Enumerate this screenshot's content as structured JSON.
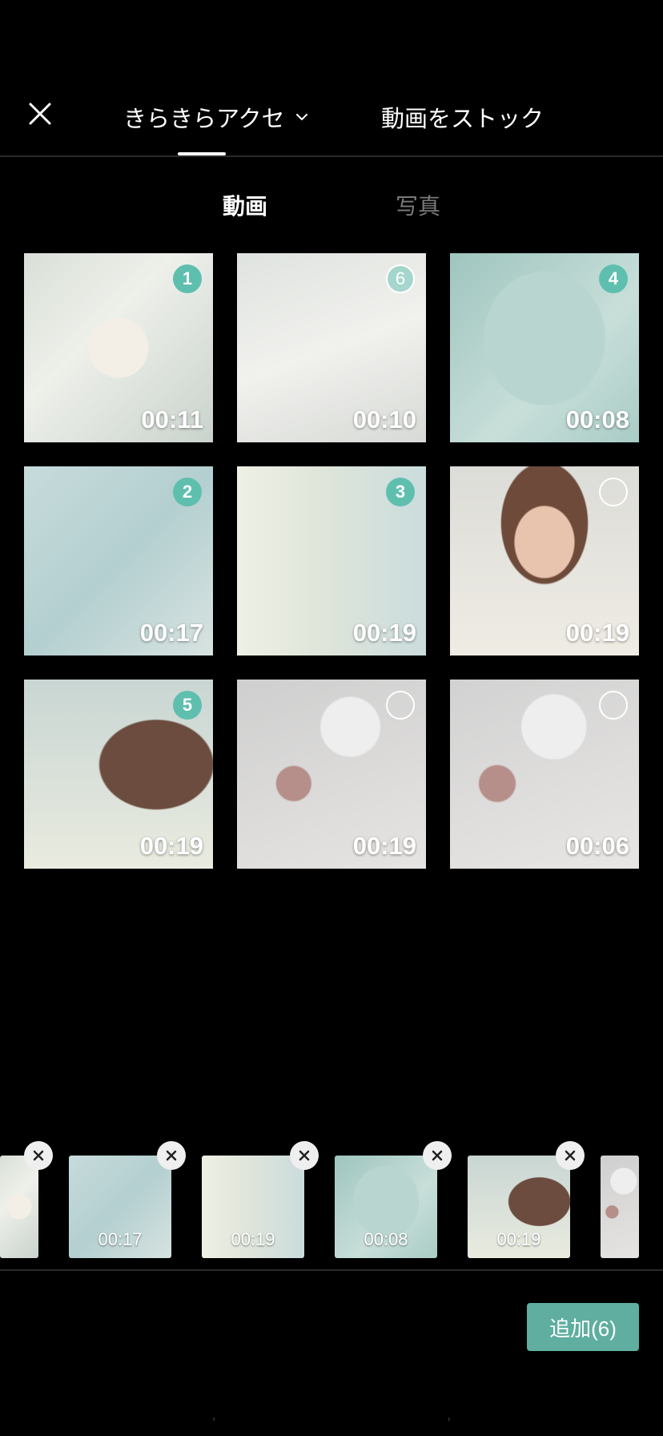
{
  "header": {
    "album_label": "きらきらアクセ",
    "stock_label": "動画をストック"
  },
  "subtabs": {
    "video": "動画",
    "photo": "写真"
  },
  "grid": [
    {
      "duration": "00:11",
      "badge": "1",
      "state": "selected"
    },
    {
      "duration": "00:10",
      "badge": "6",
      "state": "selected-latest"
    },
    {
      "duration": "00:08",
      "badge": "4",
      "state": "selected"
    },
    {
      "duration": "00:17",
      "badge": "2",
      "state": "selected"
    },
    {
      "duration": "00:19",
      "badge": "3",
      "state": "selected"
    },
    {
      "duration": "00:19",
      "badge": "",
      "state": "unselected"
    },
    {
      "duration": "00:19",
      "badge": "5",
      "state": "selected"
    },
    {
      "duration": "00:19",
      "badge": "",
      "state": "unselected"
    },
    {
      "duration": "00:06",
      "badge": "",
      "state": "unselected"
    }
  ],
  "selected_strip": [
    {
      "duration": ""
    },
    {
      "duration": "00:17"
    },
    {
      "duration": "00:19"
    },
    {
      "duration": "00:08"
    },
    {
      "duration": "00:19"
    },
    {
      "duration": ""
    }
  ],
  "add_button": "追加(6)",
  "colors": {
    "accent": "#5fbfae",
    "add_button": "#5fae9f",
    "background": "#000000"
  },
  "icons": {
    "close": "close-icon",
    "chevron": "chevron-down-icon",
    "remove": "remove-icon"
  }
}
